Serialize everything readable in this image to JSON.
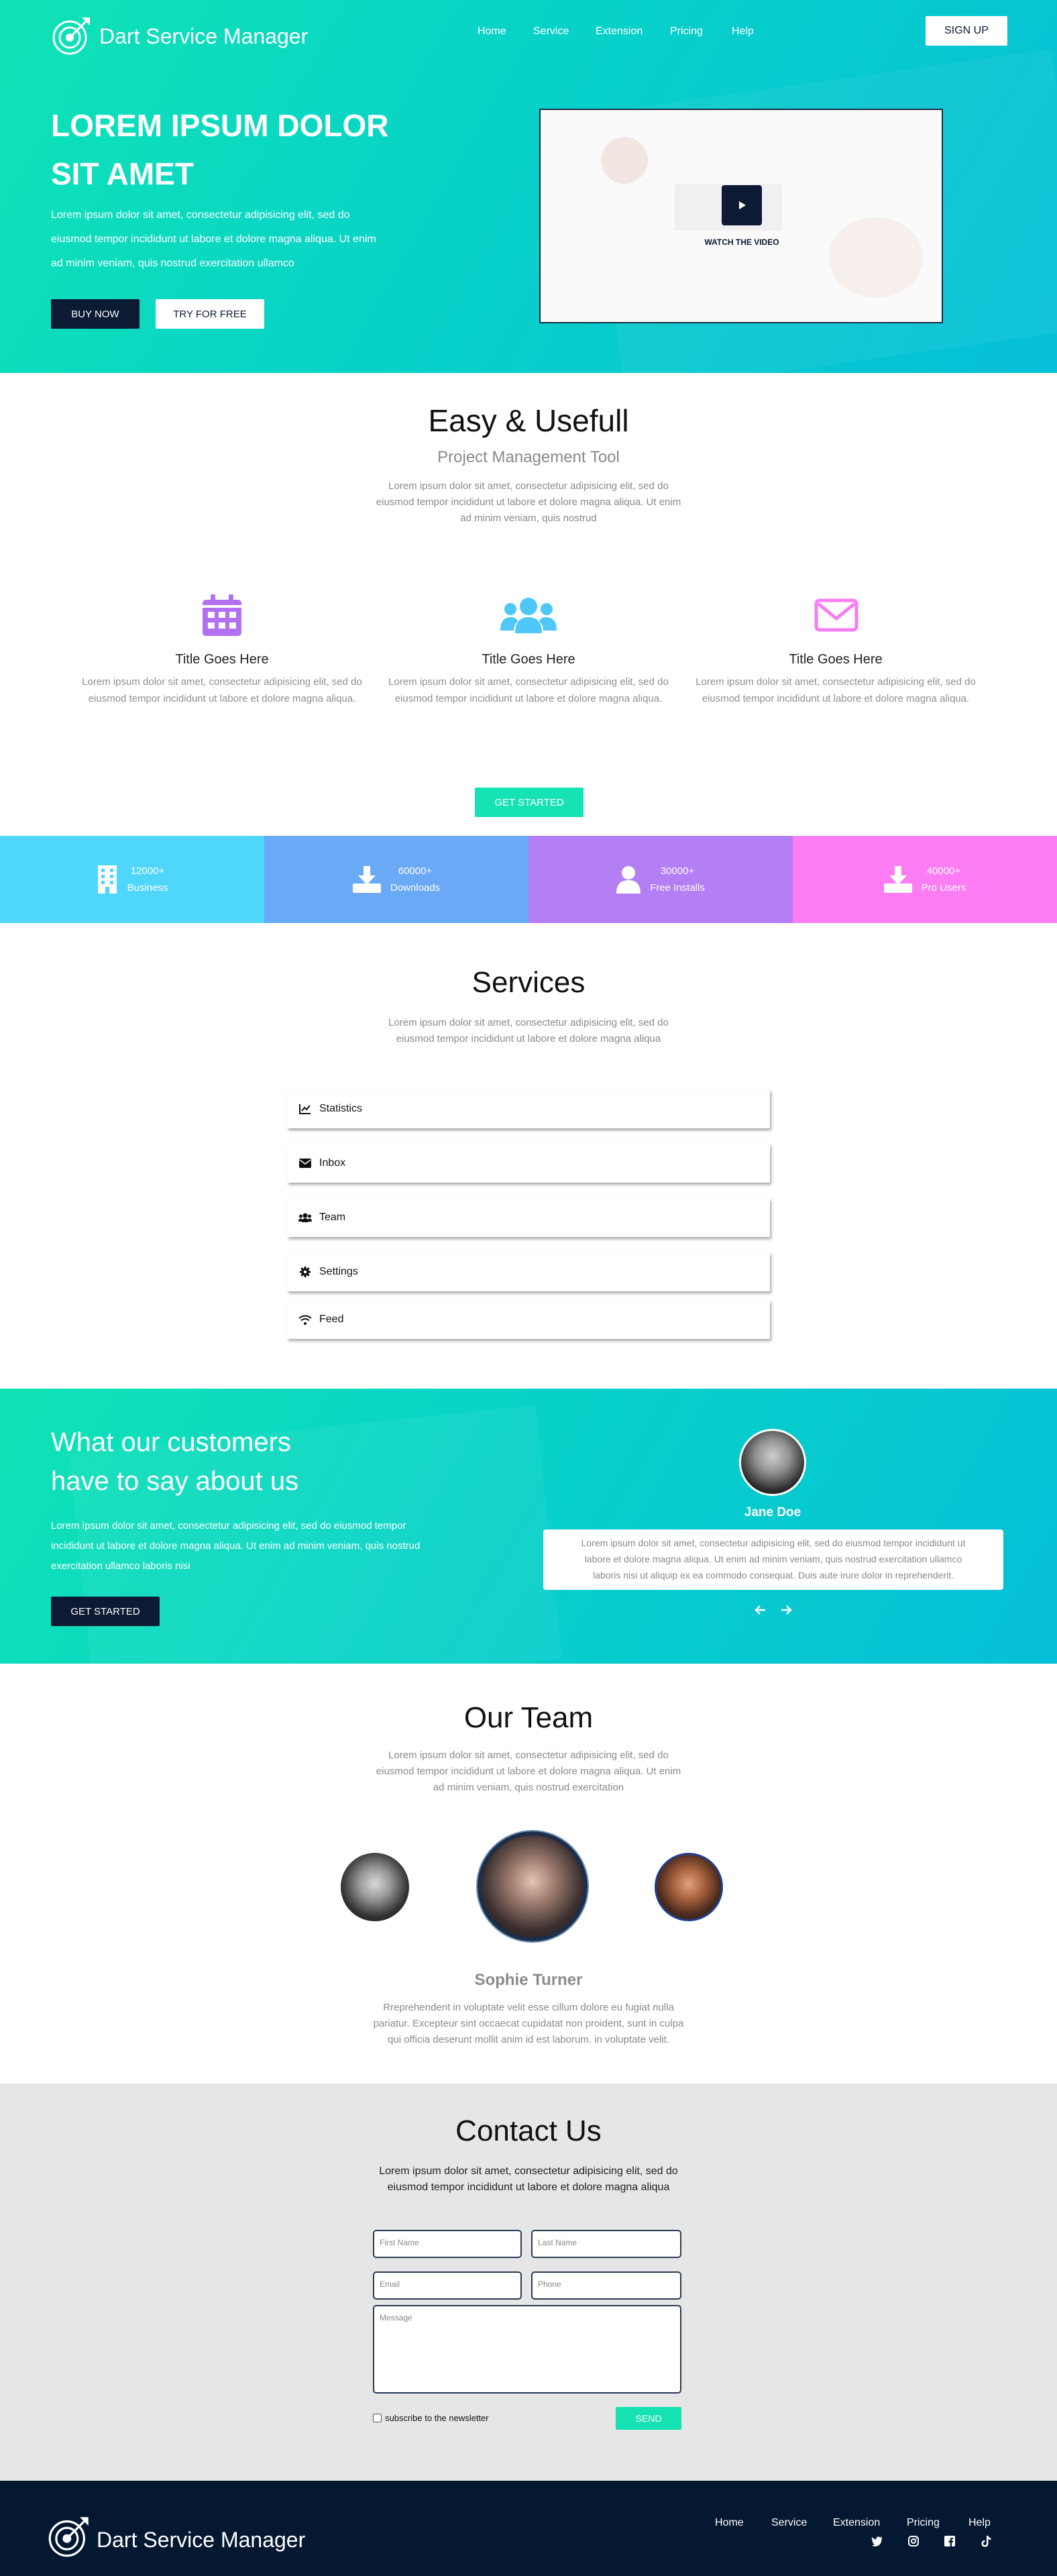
{
  "brand": {
    "name": "Dart Service Manager"
  },
  "nav": {
    "items": [
      "Home",
      "Service",
      "Extension",
      "Pricing",
      "Help"
    ],
    "signup": "SIGN UP"
  },
  "hero": {
    "title_line1": "LOREM IPSUM DOLOR",
    "title_line2": "SIT AMET",
    "text_line1": "Lorem ipsum dolor sit amet, consectetur adipisicing elit, sed do",
    "text_line2": "eiusmod tempor incididunt ut labore et dolore magna aliqua. Ut enim",
    "text_line3": "ad minim veniam, quis nostrud exercitation ullamco",
    "buy": "BUY NOW",
    "try": "TRY FOR FREE",
    "video_label": "WATCH THE VIDEO"
  },
  "intro": {
    "title": "Easy & Usefull",
    "subtitle": "Project Management Tool",
    "text_line1": "Lorem ipsum dolor sit amet, consectetur adipisicing elit, sed do",
    "text_line2": "eiusmod tempor incididunt ut labore et dolore magna aliqua. Ut enim",
    "text_line3": "ad minim veniam, quis nostrud"
  },
  "features": [
    {
      "icon": "calendar-icon",
      "title": "Title Goes Here",
      "text": "Lorem ipsum dolor sit amet, consectetur adipisicing elit, sed do eiusmod tempor incididunt ut labore et dolore magna aliqua."
    },
    {
      "icon": "users-icon",
      "title": "Title Goes Here",
      "text": "Lorem ipsum dolor sit amet, consectetur adipisicing elit, sed do eiusmod tempor incididunt ut labore et dolore magna aliqua."
    },
    {
      "icon": "envelope-icon",
      "title": "Title Goes Here",
      "text": "Lorem ipsum dolor sit amet, consectetur adipisicing elit, sed do eiusmod tempor incididunt ut labore et dolore magna aliqua."
    }
  ],
  "get_started": "GET STARTED",
  "stats": [
    {
      "value": "12000+",
      "label": "Business",
      "color": "#4fd6fb"
    },
    {
      "value": "60000+",
      "label": "Downloads",
      "color": "#6aa9f5"
    },
    {
      "value": "30000+",
      "label": "Free Installs",
      "color": "#b47ef4"
    },
    {
      "value": "40000+",
      "label": "Pro Users",
      "color": "#fb7cf3"
    }
  ],
  "services": {
    "title": "Services",
    "text_line1": "Lorem ipsum dolor sit amet, consectetur adipisicing elit, sed do",
    "text_line2": "eiusmod tempor incididunt ut labore et dolore magna aliqua",
    "items": [
      "Statistics",
      "Inbox",
      "Team",
      "Settings",
      "Feed"
    ]
  },
  "testimonials": {
    "title_line1": "What our customers",
    "title_line2": "have to say about us",
    "text_line1": "Lorem ipsum dolor sit amet, consectetur adipisicing elit, sed do eiusmod tempor",
    "text_line2": "incididunt ut labore et dolore magna aliqua. Ut enim ad minim veniam, quis nostrud",
    "text_line3": "exercitation ullamco laboris nisi",
    "button": "GET STARTED",
    "name": "Jane Doe",
    "quote_line1": "Lorem ipsum dolor sit amet, consectetur adipisicing elit, sed do eiusmod tempor incididunt ut",
    "quote_line2": "labore et dolore magna aliqua. Ut enim ad minim veniam, quis nostrud exercitation ullamco",
    "quote_line3": "laboris nisi ut aliquip ex ea commodo consequat. Duis aute irure dolor in reprehenderit."
  },
  "team": {
    "title": "Our Team",
    "text_line1": "Lorem ipsum dolor sit amet, consectetur adipisicing elit, sed do",
    "text_line2": "eiusmod tempor incididunt ut labore et dolore magna aliqua. Ut enim",
    "text_line3": "ad minim veniam, quis nostrud exercitation",
    "member_name": "Sophie Turner",
    "bio_line1": "Rreprehenderit in voluptate velit esse cillum dolore eu fugiat nulla",
    "bio_line2": "pariatur. Excepteur sint occaecat cupidatat non proident, sunt in culpa",
    "bio_line3": "qui officia deserunt mollit anim id est laborum. in voluptate velit."
  },
  "contact": {
    "title": "Contact Us",
    "text_line1": "Lorem ipsum dolor sit amet, consectetur adipisicing elit, sed do",
    "text_line2": "eiusmod tempor incididunt ut labore et dolore magna aliqua",
    "first_name": "First Name",
    "last_name": "Last Name",
    "email": "Email",
    "phone": "Phone",
    "message": "Message",
    "subscribe": "subscribe to the newsletter",
    "send": "SEND"
  },
  "footer": {
    "brand": "Dart Service Manager",
    "links": [
      "Home",
      "Service",
      "Extension",
      "Pricing",
      "Help"
    ],
    "social": [
      "twitter-icon",
      "instagram-icon",
      "facebook-icon",
      "tiktok-icon"
    ]
  }
}
